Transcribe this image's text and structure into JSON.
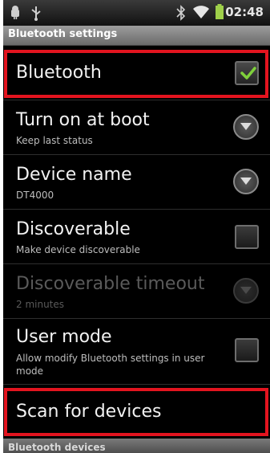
{
  "status_bar": {
    "time": "02:48",
    "left_icons": [
      "android-notification-icon",
      "usb-icon"
    ],
    "right_icons": [
      "bluetooth-icon",
      "wifi-icon",
      "battery-icon"
    ]
  },
  "title_bar": {
    "title": "Bluetooth settings"
  },
  "settings": {
    "bluetooth": {
      "label": "Bluetooth",
      "checked": true
    },
    "turn_on_at_boot": {
      "label": "Turn on at boot",
      "summary": "Keep last status"
    },
    "device_name": {
      "label": "Device name",
      "summary": "DT4000"
    },
    "discoverable": {
      "label": "Discoverable",
      "summary": "Make device discoverable",
      "checked": false
    },
    "discoverable_timeout": {
      "label": "Discoverable timeout",
      "summary": "2 minutes",
      "enabled": false
    },
    "user_mode": {
      "label": "User mode",
      "summary": "Allow modify Bluetooth settings in user mode",
      "checked": false
    },
    "scan_for_devices": {
      "label": "Scan for devices"
    }
  },
  "section_header": {
    "label": "Bluetooth devices"
  },
  "colors": {
    "highlight": "#e3141f",
    "check_green": "#7fd13b",
    "background": "#000000"
  }
}
